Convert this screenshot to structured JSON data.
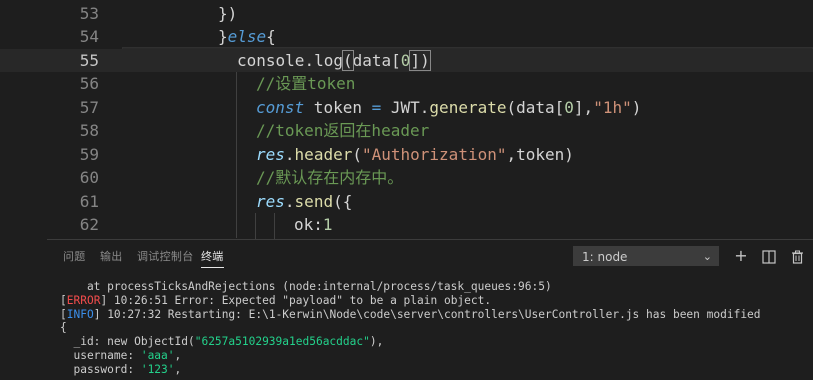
{
  "editor": {
    "lines": [
      {
        "number": "53",
        "tokens": [
          {
            "t": "})",
            "c": ""
          }
        ]
      },
      {
        "number": "54",
        "tokens": [
          {
            "t": "}",
            "c": ""
          },
          {
            "t": "else",
            "c": "kw"
          },
          {
            "t": "{",
            "c": ""
          }
        ]
      },
      {
        "number": "55",
        "tokens": [
          {
            "t": "console",
            "c": ""
          },
          {
            "t": ".",
            "c": ""
          },
          {
            "t": "log",
            "c": ""
          },
          {
            "t": "(",
            "c": ""
          },
          {
            "t": "data[",
            "c": ""
          },
          {
            "t": "0",
            "c": "num"
          },
          {
            "t": "])",
            "c": ""
          }
        ]
      },
      {
        "number": "56",
        "tokens": [
          {
            "t": "//设置token",
            "c": "cmt"
          }
        ]
      },
      {
        "number": "57",
        "tokens": [
          {
            "t": "const",
            "c": "kw"
          },
          {
            "t": " token ",
            "c": ""
          },
          {
            "t": "=",
            "c": "kw2"
          },
          {
            "t": " JWT",
            "c": ""
          },
          {
            "t": ".",
            "c": ""
          },
          {
            "t": "generate",
            "c": "fn"
          },
          {
            "t": "(data[",
            "c": ""
          },
          {
            "t": "0",
            "c": "num"
          },
          {
            "t": "],",
            "c": ""
          },
          {
            "t": "\"1h\"",
            "c": "str"
          },
          {
            "t": ")",
            "c": ""
          }
        ]
      },
      {
        "number": "58",
        "tokens": [
          {
            "t": "//token返回在header",
            "c": "cmt"
          }
        ]
      },
      {
        "number": "59",
        "tokens": [
          {
            "t": "res",
            "c": "ital"
          },
          {
            "t": ".",
            "c": ""
          },
          {
            "t": "header",
            "c": "fn"
          },
          {
            "t": "(",
            "c": ""
          },
          {
            "t": "\"Authorization\"",
            "c": "str"
          },
          {
            "t": ",token)",
            "c": ""
          }
        ]
      },
      {
        "number": "60",
        "tokens": [
          {
            "t": "//默认存在内存中。",
            "c": "cmt"
          }
        ]
      },
      {
        "number": "61",
        "tokens": [
          {
            "t": "res",
            "c": "ital"
          },
          {
            "t": ".",
            "c": ""
          },
          {
            "t": "send",
            "c": "fn"
          },
          {
            "t": "({",
            "c": ""
          }
        ]
      },
      {
        "number": "62",
        "tokens": [
          {
            "t": "ok",
            "c": ""
          },
          {
            "t": ":",
            "c": ""
          },
          {
            "t": "1",
            "c": "num"
          }
        ]
      }
    ]
  },
  "panel": {
    "tabs": [
      "问题",
      "输出",
      "调试控制台",
      "终端"
    ],
    "active_tab": "终端",
    "terminal_selector": "1: node",
    "icons": [
      "add-icon",
      "split-icon",
      "trash-icon"
    ]
  },
  "terminal": {
    "line1": "    at processTicksAndRejections (node:internal/process/task_queues:96:5)",
    "line2_tag": "ERROR",
    "line2_text": " 10:26:51 Error: Expected \"payload\" to be a plain object.",
    "line3_tag": "INFO",
    "line3_text": " 10:27:32 Restarting: E:\\1-Kerwin\\Node\\code\\server\\controllers\\UserController.js has been modified",
    "line4": "{",
    "line5_key": "  _id: new ObjectId(",
    "line5_val": "\"6257a5102939a1ed56acddac\"",
    "line5_end": "),",
    "line6_key": "  username: ",
    "line6_val": "'aaa'",
    "line6_end": ",",
    "line7_key": "  password: ",
    "line7_val": "'123'",
    "line7_end": ","
  },
  "colors": {
    "background": "#1e1e1e",
    "error": "#f14c4c",
    "info": "#3b8eea",
    "string": "#ce9178",
    "comment": "#6a9955",
    "keyword": "#569cd6",
    "function": "#dcdcaa"
  }
}
